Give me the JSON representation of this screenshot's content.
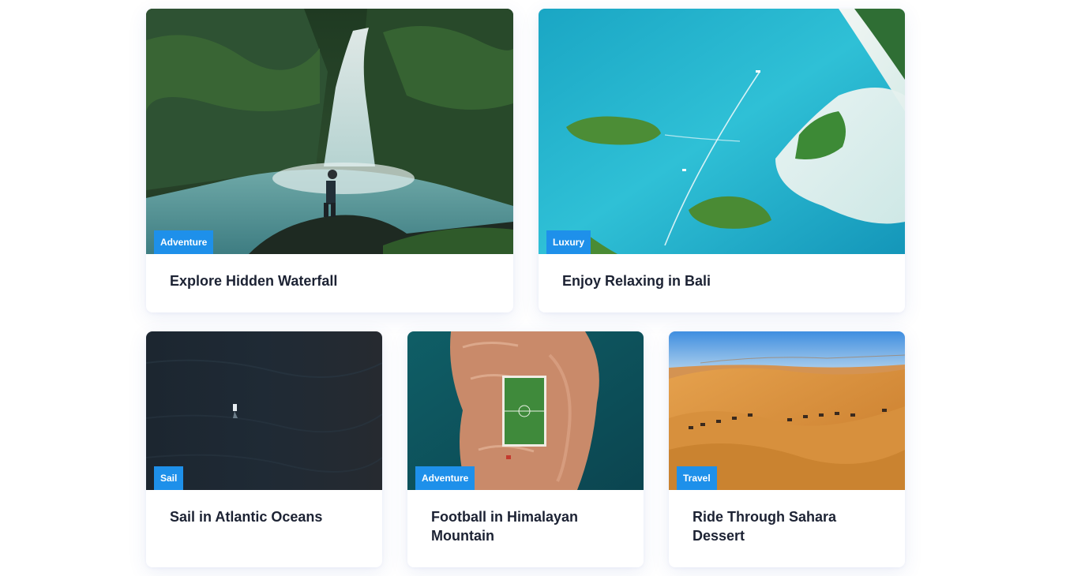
{
  "cards": [
    {
      "badge": "Adventure",
      "title": "Explore Hidden Waterfall",
      "image": "waterfall-photo"
    },
    {
      "badge": "Luxury",
      "title": "Enjoy Relaxing in Bali",
      "image": "bali-lagoon-photo"
    },
    {
      "badge": "Sail",
      "title": "Sail in Atlantic Oceans",
      "image": "dark-ocean-boat-photo"
    },
    {
      "badge": "Adventure",
      "title": "Football in Himalayan Mountain",
      "image": "island-football-field-photo"
    },
    {
      "badge": "Travel",
      "title": "Ride Through Sahara Dessert",
      "image": "sahara-camel-caravan-photo"
    }
  ],
  "colors": {
    "badge_background": "#1e90ea",
    "title_text": "#1c2233",
    "card_background": "#ffffff"
  }
}
